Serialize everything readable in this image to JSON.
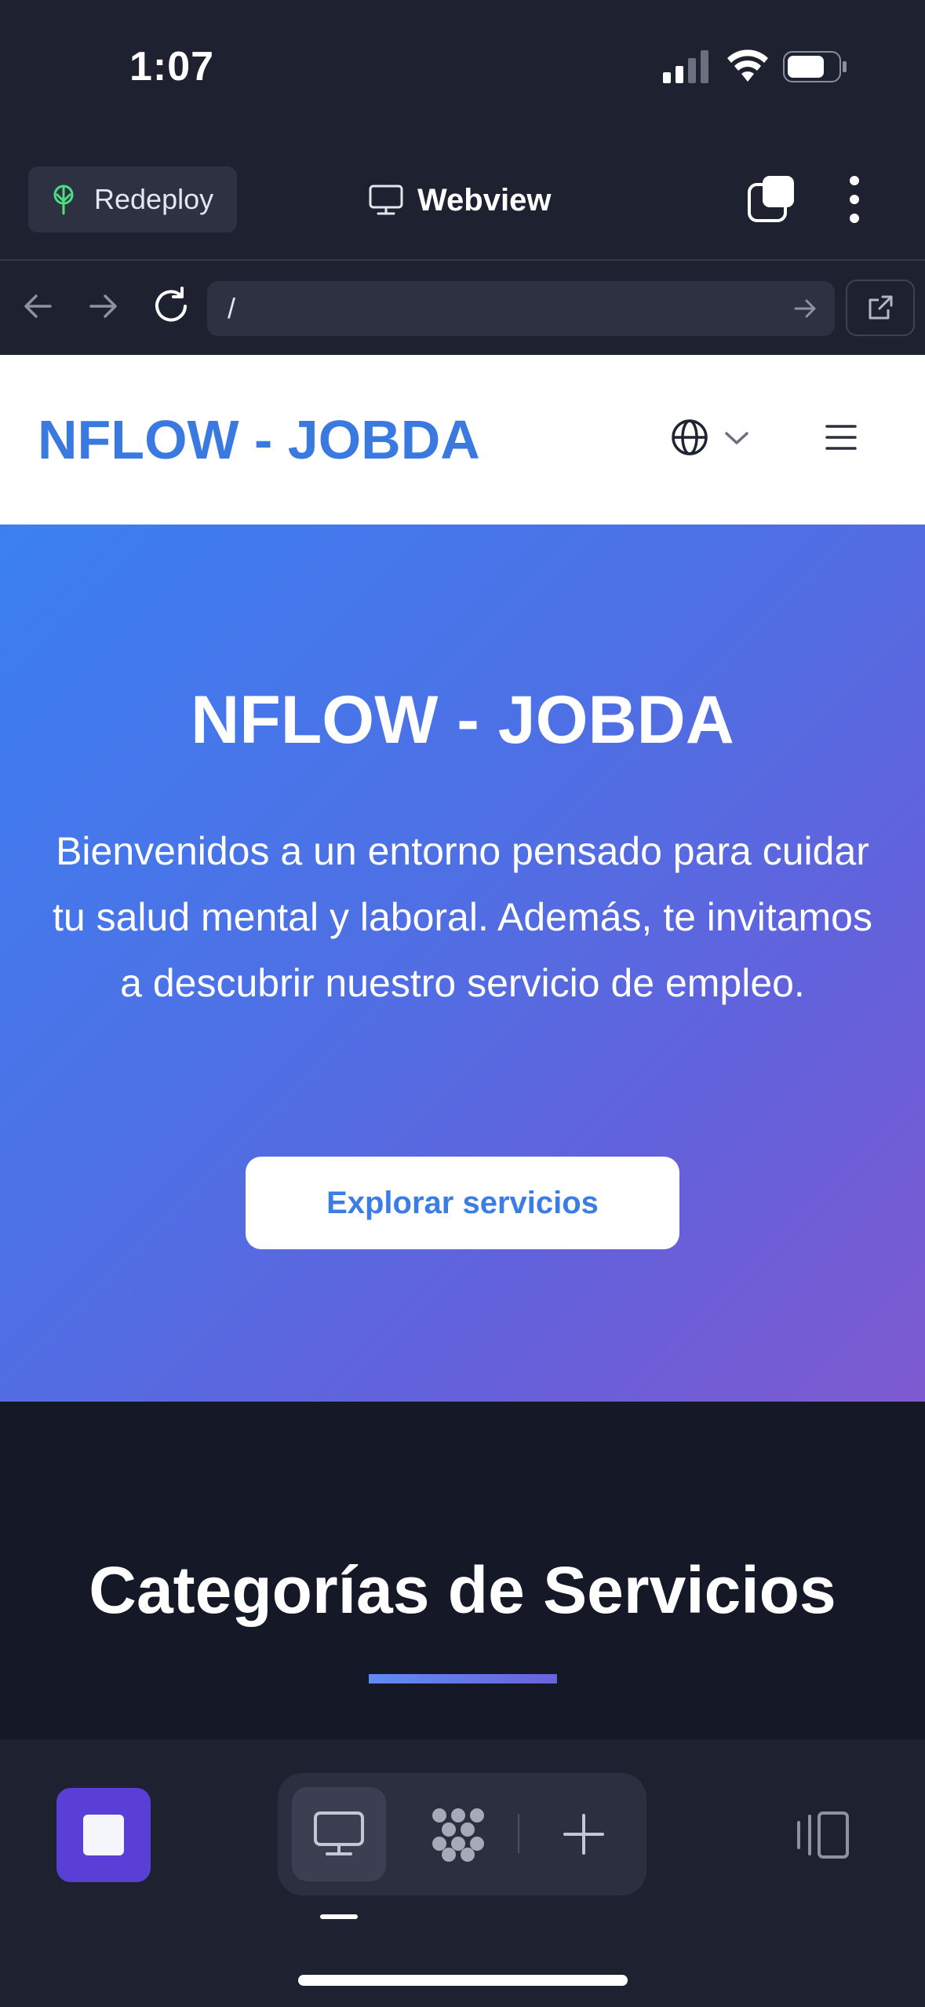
{
  "status_bar": {
    "time": "1:07"
  },
  "app_bar": {
    "redeploy_label": "Redeploy",
    "view_label": "Webview"
  },
  "url_bar": {
    "value": "/"
  },
  "site": {
    "logo": "NFLOW - JOBDA",
    "hero": {
      "title": "NFLOW - JOBDA",
      "description": "Bienvenidos a un entorno pensado para cuidar tu salud mental y laboral. Además, te invitamos a descubrir nuestro servicio de empleo.",
      "cta": "Explorar servicios"
    },
    "section_title": "Categorías de Servicios"
  },
  "colors": {
    "app_bg": "#1e2130",
    "accent_purple": "#5a3fd6",
    "brand_blue": "#3a7ae0",
    "hero_gradient_start": "#3b80f2",
    "hero_gradient_end": "#7e5ad0",
    "redeploy_icon_green": "#4ade80"
  },
  "icons": {
    "redeploy": "sprout-icon",
    "webview": "monitor-icon",
    "toggle": "overlapping-squares-icon",
    "more": "vertical-dots-icon",
    "back": "arrow-left-icon",
    "forward": "arrow-right-icon",
    "reload": "reload-icon",
    "go": "arrow-right-icon",
    "open_external": "external-link-icon",
    "language": "globe-icon",
    "menu": "hamburger-icon",
    "stop": "stop-square-icon",
    "desktop": "desktop-icon",
    "apps": "dots-grid-icon",
    "add": "plus-icon",
    "panel": "side-panel-icon"
  }
}
